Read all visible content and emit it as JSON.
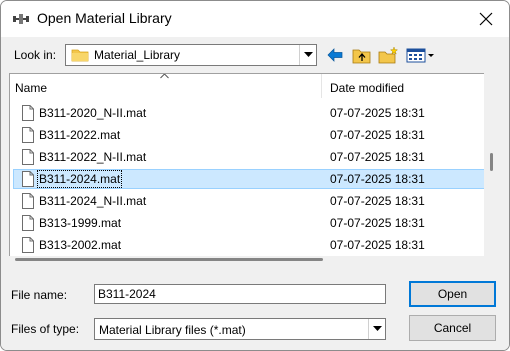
{
  "window": {
    "title": "Open Material Library",
    "close_icon": "close-icon",
    "app_icon": "material-library-app-icon"
  },
  "lookin": {
    "label": "Look in:",
    "value": "Material_Library",
    "icon": "folder-icon"
  },
  "toolbar": {
    "buttons": [
      {
        "name": "back-button",
        "icon": "back-arrow-icon"
      },
      {
        "name": "up-one-level-button",
        "icon": "up-folder-icon"
      },
      {
        "name": "new-folder-button",
        "icon": "new-folder-icon"
      },
      {
        "name": "view-menu-button",
        "icon": "view-menu-icon"
      }
    ]
  },
  "list": {
    "columns": {
      "name": "Name",
      "date": "Date modified"
    },
    "sort_column": "Name",
    "rows": [
      {
        "name": "B311-2020_N-II.mat",
        "date": "07-07-2025 18:31",
        "selected": false
      },
      {
        "name": "B311-2022.mat",
        "date": "07-07-2025 18:31",
        "selected": false
      },
      {
        "name": "B311-2022_N-II.mat",
        "date": "07-07-2025 18:31",
        "selected": false
      },
      {
        "name": "B311-2024.mat",
        "date": "07-07-2025 18:31",
        "selected": true
      },
      {
        "name": "B311-2024_N-II.mat",
        "date": "07-07-2025 18:31",
        "selected": false
      },
      {
        "name": "B313-1999.mat",
        "date": "07-07-2025 18:31",
        "selected": false
      },
      {
        "name": "B313-2002.mat",
        "date": "07-07-2025 18:31",
        "selected": false
      }
    ]
  },
  "filename": {
    "label": "File name:",
    "value": "B311-2024"
  },
  "filetype": {
    "label": "Files of type:",
    "value": "Material Library files (*.mat)"
  },
  "buttons": {
    "open": "Open",
    "cancel": "Cancel"
  },
  "colors": {
    "selection": "#cce8ff",
    "selection_border": "#99d1ff",
    "default_button_border": "#0078d7",
    "back_arrow": "#0a7ad4",
    "folder": "#f3c64b"
  }
}
